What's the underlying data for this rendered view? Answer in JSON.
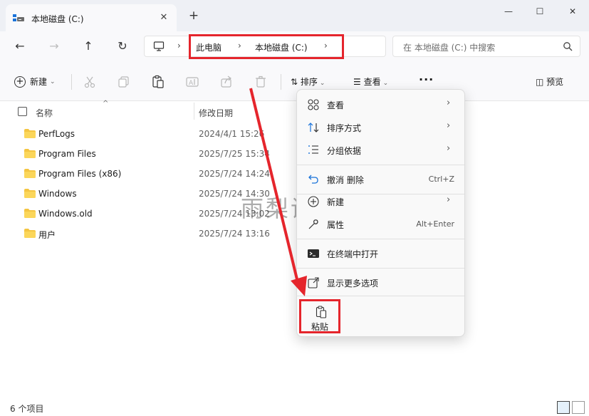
{
  "window": {
    "tab_title": "本地磁盘 (C:)",
    "tab_close": "✕",
    "new_tab": "+",
    "minimize": "—",
    "maximize": "☐",
    "close": "✕"
  },
  "nav": {
    "back": "←",
    "forward": "→",
    "up": "↑",
    "refresh": "↻"
  },
  "address": {
    "root_sep": "›",
    "crumbs": [
      "此电脑",
      "本地磁盘 (C:)"
    ],
    "sep": "›",
    "search_placeholder": "在 本地磁盘 (C:) 中搜索"
  },
  "toolbar": {
    "new_label": "新建",
    "sort_label": "排序",
    "view_label": "查看",
    "more": "···",
    "preview_label": "预览"
  },
  "columns": {
    "name": "名称",
    "date": "修改日期"
  },
  "files": [
    {
      "name": "PerfLogs",
      "date": "2024/4/1 15:26"
    },
    {
      "name": "Program Files",
      "date": "2025/7/25 15:34"
    },
    {
      "name": "Program Files (x86)",
      "date": "2025/7/24 14:24"
    },
    {
      "name": "Windows",
      "date": "2025/7/24 14:30"
    },
    {
      "name": "Windows.old",
      "date": "2025/7/24 13:02"
    },
    {
      "name": "用户",
      "date": "2025/7/24 13:16"
    }
  ],
  "status": {
    "count": "6 个项目"
  },
  "context_menu": {
    "items": [
      {
        "label": "查看",
        "arrow": "›"
      },
      {
        "label": "排序方式",
        "arrow": "›"
      },
      {
        "label": "分组依据",
        "arrow": "›"
      },
      {
        "label": "撤消 删除",
        "shortcut": "Ctrl+Z"
      },
      {
        "label": "新建",
        "arrow": "›"
      },
      {
        "label": "属性",
        "shortcut": "Alt+Enter"
      },
      {
        "label": "在终端中打开"
      },
      {
        "label": "显示更多选项"
      }
    ],
    "paste_label": "粘贴"
  },
  "watermark": "雨梨设计",
  "colors": {
    "highlight_red": "#e5252c",
    "folder_yellow": "#f4c542"
  }
}
